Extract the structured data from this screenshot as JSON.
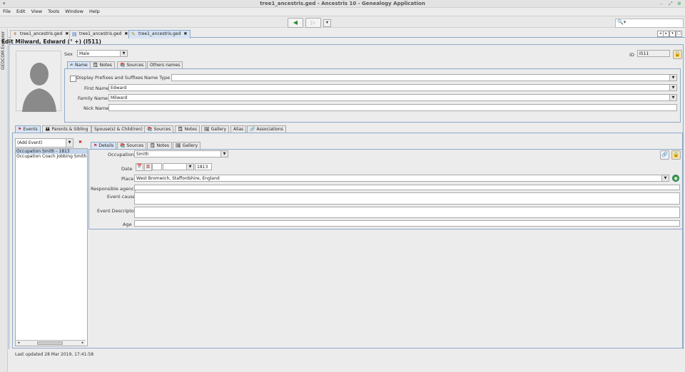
{
  "window": {
    "title": "tree1_ancestris.ged - Ancestris 10 - Genealogy Application",
    "btn_min": "–",
    "btn_max": "⤢",
    "btn_close": "⊗"
  },
  "menu": [
    "File",
    "Edit",
    "View",
    "Tools",
    "Window",
    "Help"
  ],
  "toolbar": {
    "back": "◀",
    "forward": "▷",
    "search_placeholder": ""
  },
  "side_panel": {
    "label": "GEDCOM Explorer"
  },
  "doc_tabs": [
    {
      "label": "tree1_ancestris.ged",
      "close": "✖"
    },
    {
      "label": "tree1_ancestris.ged",
      "close": "✖"
    },
    {
      "label": "tree1_ancestris.ged",
      "close": "✖"
    }
  ],
  "editor": {
    "title": "Edit Milward, Edward (° +) (I511)",
    "sex_label": "Sex",
    "sex_value": "Male",
    "id_label": "ID",
    "id_value": "I511",
    "name_tabs": [
      "Name",
      "Notes",
      "Sources",
      "Others names"
    ],
    "display_prefixes_label": "Display Prefixes and Suffixes",
    "name_type_label": "Name Type",
    "name_type_value": "",
    "first_name_label": "First Name",
    "first_name_value": "Edward",
    "family_name_label": "Family Name",
    "family_name_value": "Milward",
    "nick_name_label": "Nick Name",
    "nick_name_value": ""
  },
  "main_tabs": [
    "Events",
    "Parents & Sibling",
    "Spouse(s) & Child(ren)",
    "Sources",
    "Notes",
    "Gallery",
    "Alias",
    "Associations"
  ],
  "events": {
    "add_event_placeholder": "(Add Event)",
    "items": [
      "Occupation Smith - 1813",
      "Occupation Coach Jobbing Smith -"
    ],
    "detail_tabs": [
      "Details",
      "Sources",
      "Notes",
      "Gallery"
    ],
    "occupation_label": "Occupation",
    "occupation_value": "Smith",
    "date_label": "Date",
    "date_year": "1813",
    "place_label": "Place",
    "place_value": "West Bromwich, Staffordshire, England",
    "agency_label": "Responsible agency",
    "cause_label": "Event cause",
    "descriptor_label": "Event Descriptor",
    "age_label": "Age"
  },
  "status": {
    "last_updated": "Last updated 28 Mar 2019, 17:41:58"
  }
}
